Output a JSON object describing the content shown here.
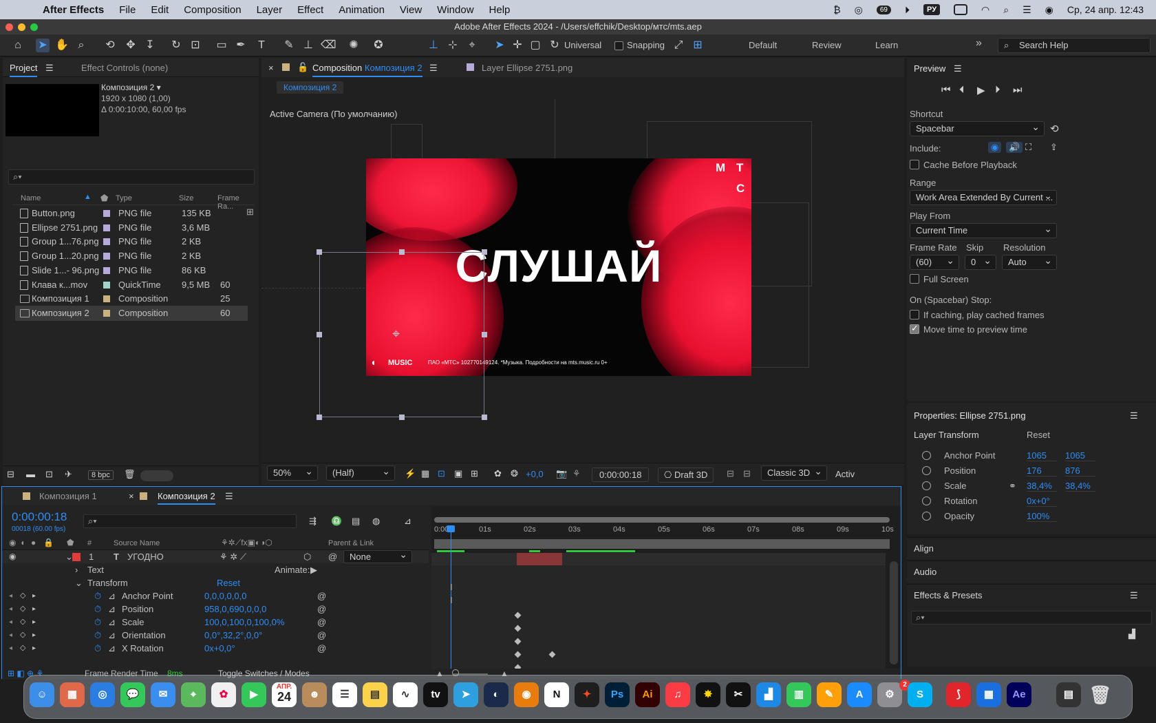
{
  "menubar": {
    "app": "After Effects",
    "items": [
      "File",
      "Edit",
      "Composition",
      "Layer",
      "Effect",
      "Animation",
      "View",
      "Window",
      "Help"
    ],
    "lang": "РУ",
    "badge": "69",
    "datetime": "Ср, 24 апр.  12:43"
  },
  "window": {
    "title": "Adobe After Effects 2024 - /Users/effchik/Desktop/мтс/mts.aep"
  },
  "toolbar": {
    "universal": "Universal",
    "snapping": "Snapping",
    "workspaces": [
      "Default",
      "Review",
      "Learn"
    ],
    "search_placeholder": "Search Help"
  },
  "project": {
    "tab_project": "Project",
    "tab_effect": "Effect Controls (none)",
    "comp_name": "Композиция 2 ▾",
    "comp_size": "1920 x 1080 (1,00)",
    "comp_dur": "Δ 0:00:10:00, 60,00 fps",
    "headers": {
      "name": "Name",
      "type": "Type",
      "size": "Size",
      "frame": "Frame Ra..."
    },
    "files": [
      {
        "name": "Button.png",
        "type": "PNG file",
        "size": "135 KB",
        "fps": "",
        "color": "#b7a9d9"
      },
      {
        "name": "Ellipse 2751.png",
        "type": "PNG file",
        "size": "3,6 MB",
        "fps": "",
        "color": "#b7a9d9"
      },
      {
        "name": "Group 1...76.png",
        "type": "PNG file",
        "size": "2 KB",
        "fps": "",
        "color": "#b7a9d9"
      },
      {
        "name": "Group 1...20.png",
        "type": "PNG file",
        "size": "2 KB",
        "fps": "",
        "color": "#b7a9d9"
      },
      {
        "name": "Slide 1...- 96.png",
        "type": "PNG file",
        "size": "86 KB",
        "fps": "",
        "color": "#b7a9d9"
      },
      {
        "name": "Клава к...mov",
        "type": "QuickTime",
        "size": "9,5 MB",
        "fps": "60",
        "color": "#9fd4c7"
      },
      {
        "name": "Композиция 1",
        "type": "Composition",
        "size": "",
        "fps": "25",
        "color": "#c9b27f"
      },
      {
        "name": "Композиция 2",
        "type": "Composition",
        "size": "",
        "fps": "60",
        "color": "#c9b27f"
      }
    ],
    "bpc": "8 bpc"
  },
  "viewer": {
    "tab_comp_prefix": "Composition",
    "tab_comp_name": "Композиция 2",
    "tab_layer": "Layer Ellipse 2751.png",
    "crumb": "Композиция 2",
    "camera": "Active Camera (По умолчанию)",
    "headline": "СЛУШАЙ",
    "logo_m": "М",
    "logo_t": "Т",
    "logo_c": "С",
    "music": "MUSIC",
    "legal": "ПАО «МТС» 102770149124. *Музыка. Подробности на mts.music.ru  0+",
    "zoom": "50%",
    "resolution": "(Half)",
    "exposure": "+0,0",
    "timecode": "0:00:00:18",
    "draft": "Draft 3D",
    "renderer": "Classic 3D",
    "active": "Activ"
  },
  "preview": {
    "title": "Preview",
    "shortcut_label": "Shortcut",
    "shortcut": "Spacebar",
    "include": "Include:",
    "cache": "Cache Before Playback",
    "range_label": "Range",
    "range": "Work Area Extended By Current ...",
    "play_from_label": "Play From",
    "play_from": "Current Time",
    "fr_label": "Frame Rate",
    "skip_label": "Skip",
    "res_label": "Resolution",
    "fr": "(60)",
    "skip": "0",
    "res": "Auto",
    "full": "Full Screen",
    "stop_label": "On (Spacebar) Stop:",
    "if_caching": "If caching, play cached frames",
    "move_time": "Move time to preview time"
  },
  "properties": {
    "title": "Properties: Ellipse 2751.png",
    "section": "Layer Transform",
    "reset": "Reset",
    "rows": [
      {
        "name": "Anchor Point",
        "v1": "1065",
        "v2": "1065"
      },
      {
        "name": "Position",
        "v1": "176",
        "v2": "876"
      },
      {
        "name": "Scale",
        "v1": "38,4%",
        "v2": "38,4%"
      },
      {
        "name": "Rotation",
        "v1": "0x+0°",
        "v2": ""
      },
      {
        "name": "Opacity",
        "v1": "100%",
        "v2": ""
      }
    ]
  },
  "side": {
    "align": "Align",
    "audio": "Audio",
    "effects": "Effects & Presets"
  },
  "timeline": {
    "tab1": "Композиция 1",
    "tab2": "Композиция 2",
    "timecode": "0:00:00:18",
    "frames": "00018 (60.00 fps)",
    "source_name": "Source Name",
    "parent": "Parent & Link",
    "num": "#",
    "layer": {
      "num": "1",
      "name": "УГОДНО",
      "parent": "None"
    },
    "text": "Text",
    "animate": "Animate:",
    "transform": "Transform",
    "reset": "Reset",
    "props": [
      {
        "name": "Anchor Point",
        "value": "0,0,0,0,0,0"
      },
      {
        "name": "Position",
        "value": "958,0,690,0,0,0"
      },
      {
        "name": "Scale",
        "value": "100,0,100,0,100,0%"
      },
      {
        "name": "Orientation",
        "value": "0,0°,32,2°,0,0°"
      },
      {
        "name": "X Rotation",
        "value": "0x+0,0°"
      }
    ],
    "ruler": [
      "0:00s",
      "01s",
      "02s",
      "03s",
      "04s",
      "05s",
      "06s",
      "07s",
      "08s",
      "09s",
      "10s"
    ],
    "frame_render": "Frame Render Time",
    "frame_ms": "8ms",
    "toggle": "Toggle Switches / Modes"
  },
  "dock": {
    "calendar_month": "АПР.",
    "calendar_day": "24",
    "badge_settings": "2"
  }
}
